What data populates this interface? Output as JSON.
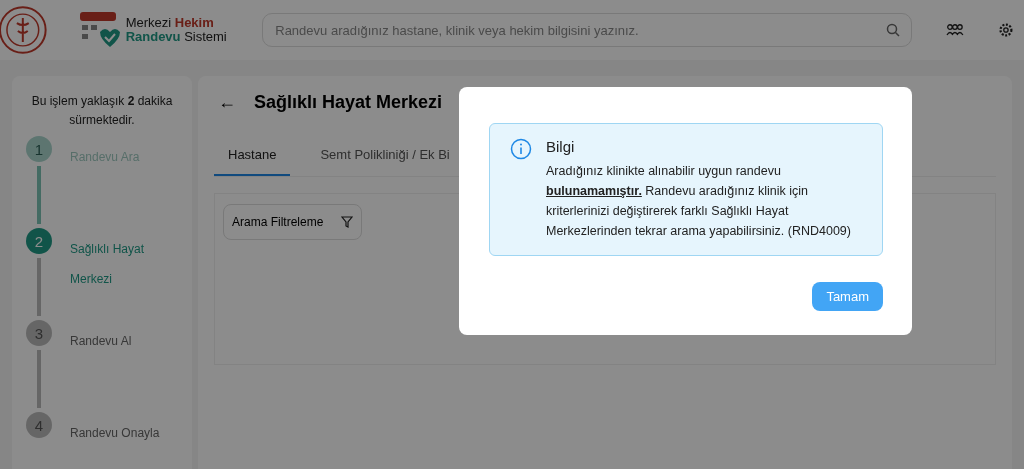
{
  "header": {
    "logo_line_1": "Merkezi **Hekim**",
    "logo_line_2": "**Randevu** Sistemi",
    "search": {
      "placeholder": "Randevu aradığınız hastane, klinik veya hekim bilgisini yazınız."
    }
  },
  "sidebar": {
    "intro": "Bu işlem yaklaşık **2** dakika sürmektedir.",
    "steps": [
      {
        "number": "1",
        "label": "Randevu Ara",
        "completed": true,
        "selected": false
      },
      {
        "number": "2",
        "label": "Sağlıklı Hayat Merkezi",
        "completed": false,
        "selected": true
      },
      {
        "number": "3",
        "label": "Randevu Al",
        "completed": false,
        "selected": false
      },
      {
        "number": "4",
        "label": "Randevu Onayla",
        "completed": false,
        "selected": false
      }
    ]
  },
  "main": {
    "back": "←",
    "title": "Sağlıklı Hayat Merkezi",
    "tabs": [
      {
        "label": "Hastane",
        "selected": true
      },
      {
        "label": "Semt Polikliniği / Ek Bi",
        "selected": false
      }
    ],
    "filter_button": "Arama Filtreleme"
  },
  "modal": {
    "title": "Bilgi",
    "message": "Aradığınız klinikte alınabilir uygun randevu **bulunamamıştır.** Randevu aradığınız klinik için kriterlerinizi değiştirerek farklı Sağlıklı Hayat Merkezlerinden tekrar arama yapabilirsiniz. (RND4009)",
    "button": "Tamam"
  }
}
